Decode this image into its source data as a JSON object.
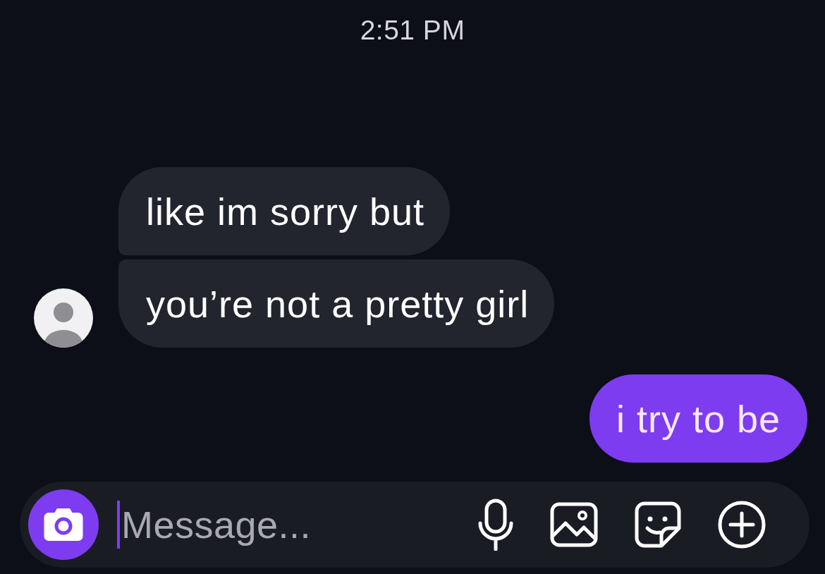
{
  "timestamp": "2:51 PM",
  "messages": [
    {
      "kind": "received",
      "text": "like im sorry but"
    },
    {
      "kind": "received",
      "text": "you’re not a pretty girl"
    },
    {
      "kind": "sent",
      "text": "i try to be"
    }
  ],
  "composer": {
    "placeholder": "Message..."
  }
}
